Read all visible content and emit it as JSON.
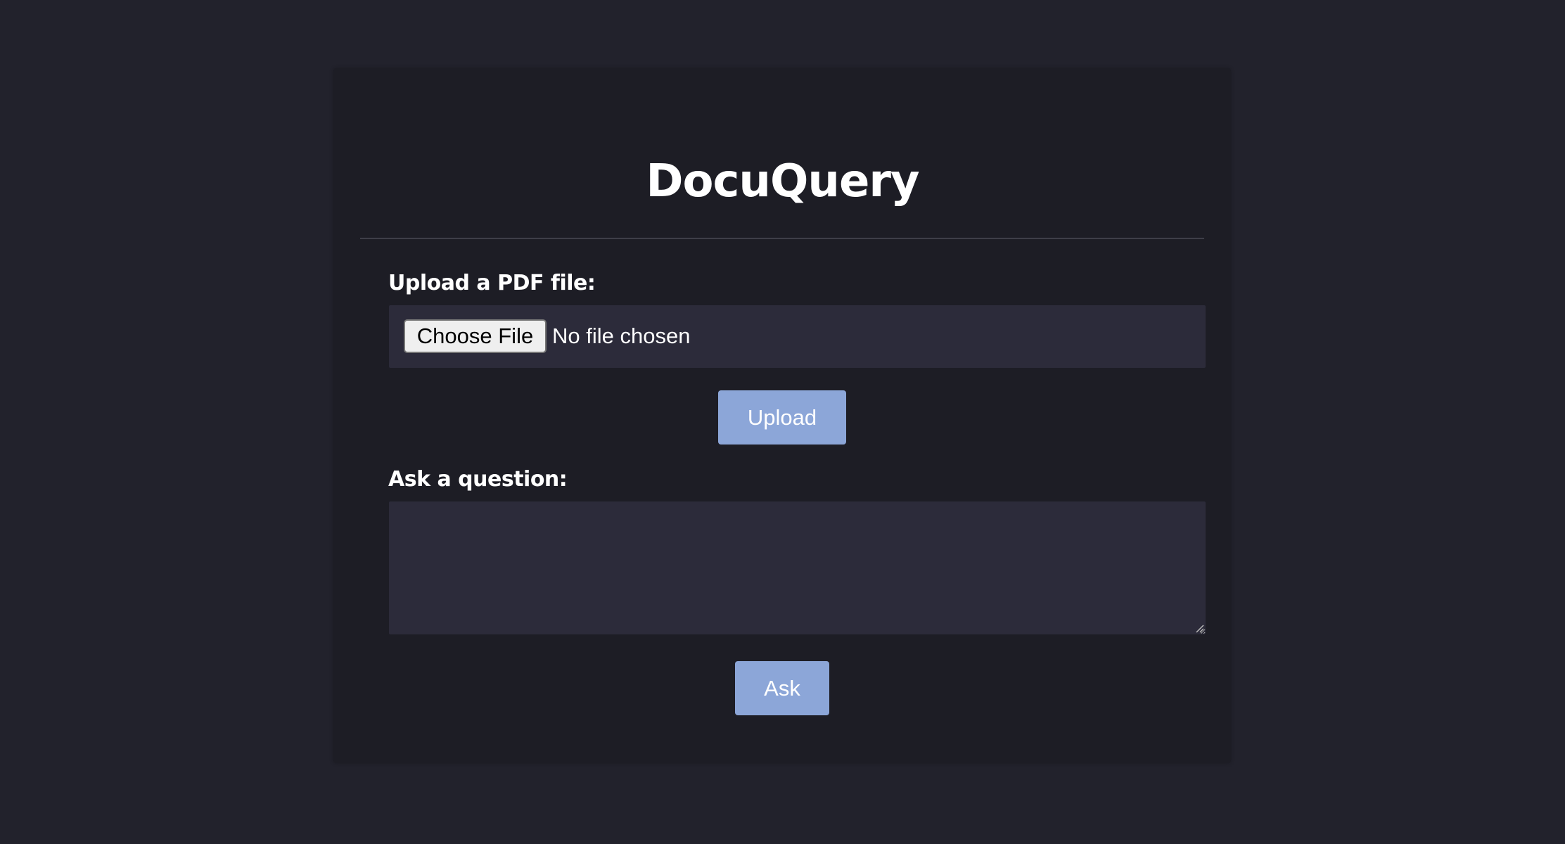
{
  "app": {
    "title": "DocuQuery"
  },
  "upload": {
    "label": "Upload a PDF file:",
    "choose_button": "Choose File",
    "file_status": "No file chosen",
    "submit_label": "Upload"
  },
  "question": {
    "label": "Ask a question:",
    "value": "",
    "submit_label": "Ask"
  },
  "colors": {
    "page_background": "#22222c",
    "card_background": "#1d1d25",
    "field_background": "#2c2b3a",
    "button_accent": "#8ca6d8"
  }
}
